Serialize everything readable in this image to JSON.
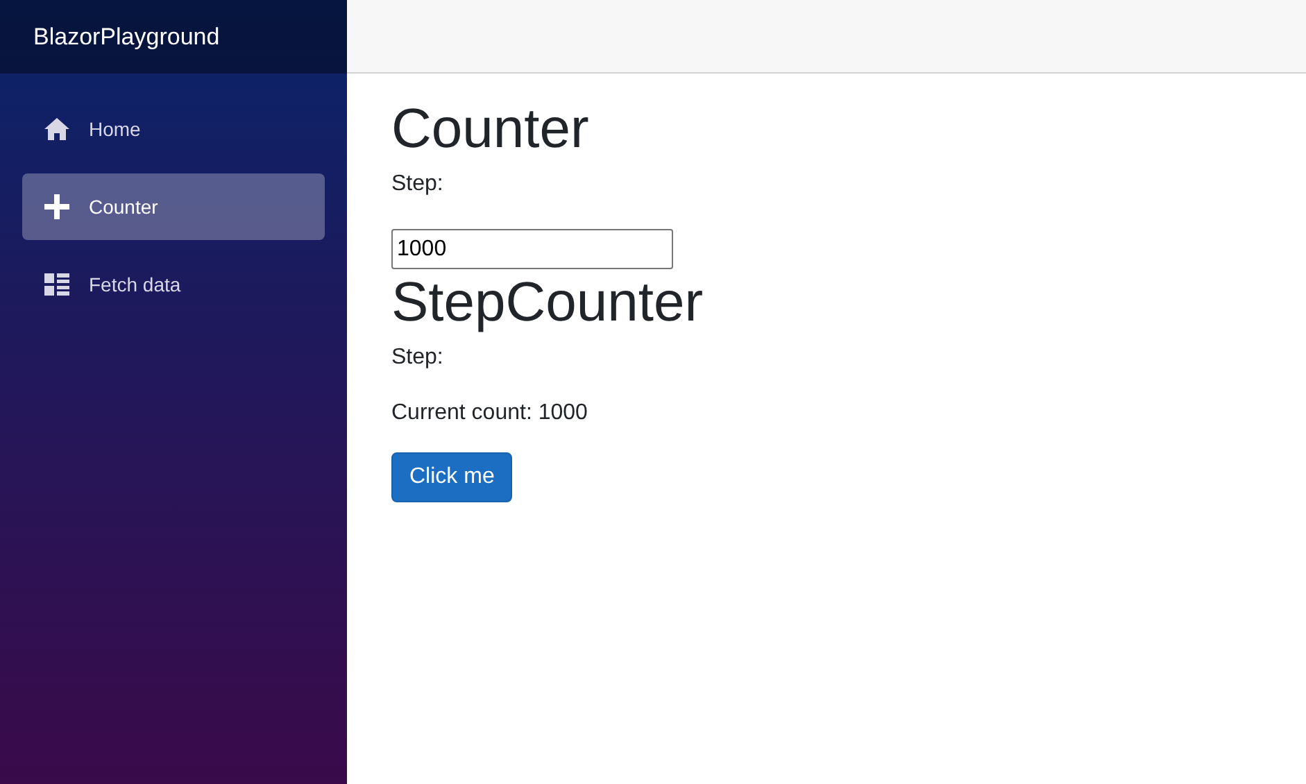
{
  "sidebar": {
    "brand": "BlazorPlayground",
    "items": [
      {
        "label": "Home",
        "selected": false
      },
      {
        "label": "Counter",
        "selected": true
      },
      {
        "label": "Fetch data",
        "selected": false
      }
    ]
  },
  "main": {
    "title": "Counter",
    "step_label": "Step:",
    "step_input": {
      "value": "1000"
    },
    "subtitle": "StepCounter",
    "sub_step_label": "Step:",
    "current_count": "Current count: 1000",
    "button": "Click me"
  }
}
